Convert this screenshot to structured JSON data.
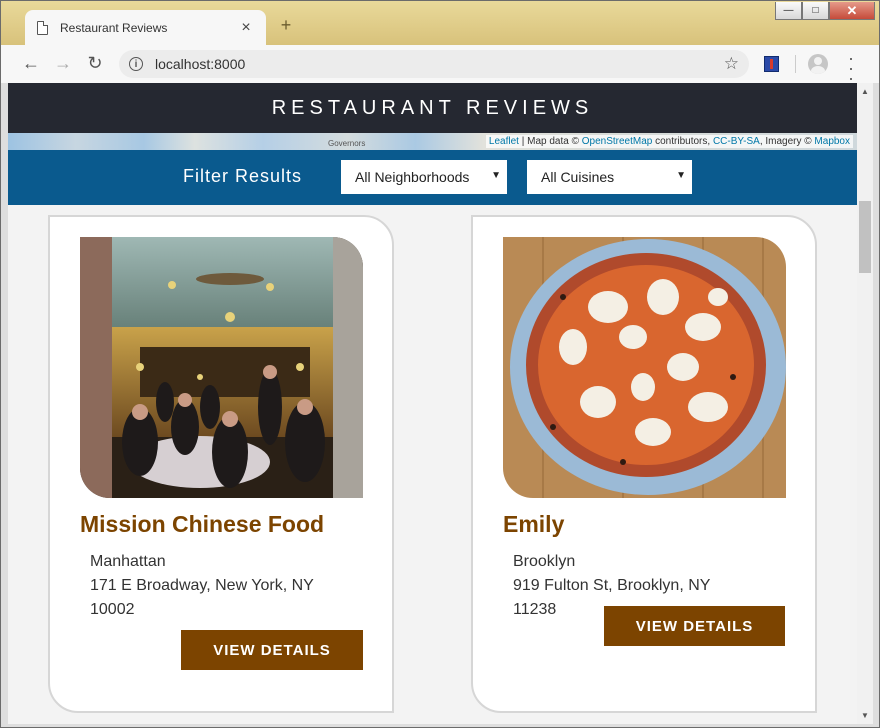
{
  "browser": {
    "tab_title": "Restaurant Reviews",
    "tab_close": "×",
    "new_tab": "+",
    "url": "localhost:8000",
    "window_buttons": [
      "—",
      "□",
      "✕"
    ]
  },
  "site": {
    "title": "RESTAURANT REVIEWS",
    "map_label": "Governors",
    "attribution": {
      "leaflet": "Leaflet",
      "map_data": " | Map data © ",
      "osm": "OpenStreetMap",
      "contributors": " contributors, ",
      "license": "CC-BY-SA",
      "imagery": ", Imagery © ",
      "mapbox": "Mapbox"
    },
    "filter": {
      "label": "Filter Results",
      "neighborhoods": "All Neighborhoods",
      "cuisines": "All Cuisines"
    }
  },
  "restaurants": [
    {
      "name": "Mission Chinese Food",
      "neighborhood": "Manhattan",
      "address": "171 E Broadway, New York, NY 10002",
      "button": "VIEW DETAILS"
    },
    {
      "name": "Emily",
      "neighborhood": "Brooklyn",
      "address": "919 Fulton St, Brooklyn, NY 11238",
      "button": "VIEW DETAILS"
    }
  ],
  "colors": {
    "header_bg": "#252831",
    "filter_bg": "#0a5a8e",
    "accent_brown": "#7c4400"
  }
}
